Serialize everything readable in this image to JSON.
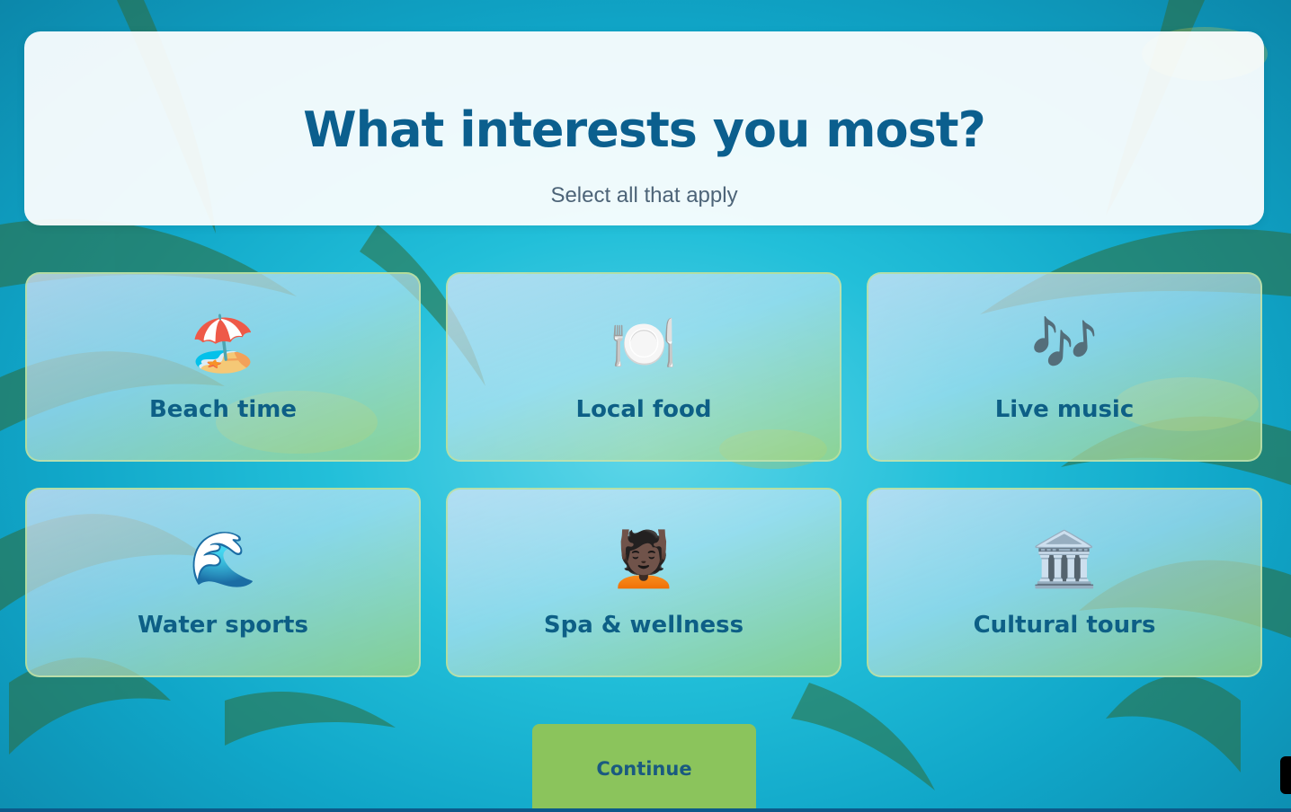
{
  "header": {
    "title": "What interests you most?",
    "subtitle": "Select all that apply"
  },
  "interests": [
    {
      "label": "Beach time",
      "icon": "beach-umbrella-icon",
      "emoji": "🏖️"
    },
    {
      "label": "Local food",
      "icon": "fork-knife-plate-icon",
      "emoji": "🍽️"
    },
    {
      "label": "Live music",
      "icon": "music-notes-icon",
      "emoji": "🎶"
    },
    {
      "label": "Water sports",
      "icon": "wave-icon",
      "emoji": "🌊"
    },
    {
      "label": "Spa & wellness",
      "icon": "massage-icon",
      "emoji": "💆🏿"
    },
    {
      "label": "Cultural tours",
      "icon": "classical-building-icon",
      "emoji": "🏛️"
    }
  ],
  "actions": {
    "continue_label": "Continue"
  },
  "colors": {
    "title": "#0b5f8e",
    "subtitle": "#4d6478",
    "card_label": "#0d5f86",
    "continue_bg": "#8bc45c",
    "sky": "#22bfd9"
  }
}
